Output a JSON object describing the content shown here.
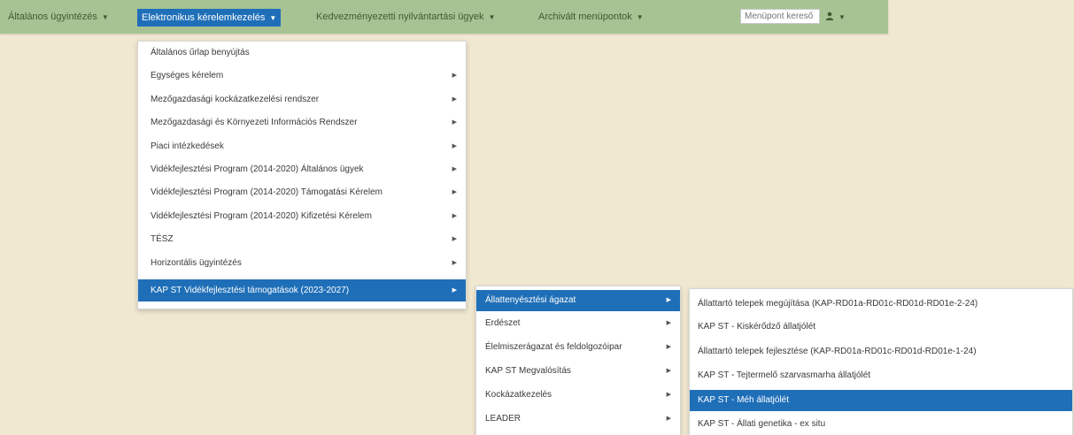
{
  "navbar": {
    "items": [
      {
        "label": "Általános ügyintézés"
      },
      {
        "label": "Elektronikus kérelemkezelés"
      },
      {
        "label": "Kedvezményezetti nyilvántartási ügyek"
      },
      {
        "label": "Archivált menüpontok"
      }
    ],
    "search_placeholder": "Menüpont kereső",
    "user_icon": "user-icon",
    "accent_color": "#1f6fb8",
    "navbar_color": "#a7c394"
  },
  "menu_level1": [
    {
      "label": "Általános űrlap benyújtás",
      "has_submenu": false
    },
    {
      "label": "Egységes kérelem",
      "has_submenu": true
    },
    {
      "label": "Mezőgazdasági kockázatkezelési rendszer",
      "has_submenu": true
    },
    {
      "label": "Mezőgazdasági és Környezeti Információs Rendszer",
      "has_submenu": true
    },
    {
      "label": "Piaci intézkedések",
      "has_submenu": true
    },
    {
      "label": "Vidékfejlesztési Program (2014-2020) Általános ügyek",
      "has_submenu": true
    },
    {
      "label": "Vidékfejlesztési Program (2014-2020) Támogatási Kérelem",
      "has_submenu": true
    },
    {
      "label": "Vidékfejlesztési Program (2014-2020) Kifizetési Kérelem",
      "has_submenu": true
    },
    {
      "label": "TÉSZ",
      "has_submenu": true
    },
    {
      "label": "Horizontális ügyintézés",
      "has_submenu": true
    },
    {
      "label": "KAP ST Vidékfejlesztési támogatások (2023-2027)",
      "has_submenu": true,
      "active": true
    }
  ],
  "menu_level2": [
    {
      "label": "Állattenyésztési ágazat",
      "active": true
    },
    {
      "label": "Erdészet"
    },
    {
      "label": "Élelmiszerágazat és feldolgozóipar"
    },
    {
      "label": "KAP ST Megvalósítás"
    },
    {
      "label": "Kockázatkezelés"
    },
    {
      "label": "LEADER"
    }
  ],
  "menu_level3": [
    {
      "label": "Állattartó telepek megújítása (KAP-RD01a-RD01c-RD01d-RD01e-2-24)"
    },
    {
      "label": "KAP ST - Kiskérődző állatjólét"
    },
    {
      "label": "Állattartó telepek fejlesztése (KAP-RD01a-RD01c-RD01d-RD01e-1-24)"
    },
    {
      "label": "KAP ST - Tejtermelő szarvasmarha állatjólét"
    },
    {
      "label": "KAP ST - Méh állatjólét",
      "active": true
    },
    {
      "label": "KAP ST - Állati genetika - ex situ"
    }
  ],
  "arrow_glyph": "▶",
  "caret_glyph": "▼"
}
